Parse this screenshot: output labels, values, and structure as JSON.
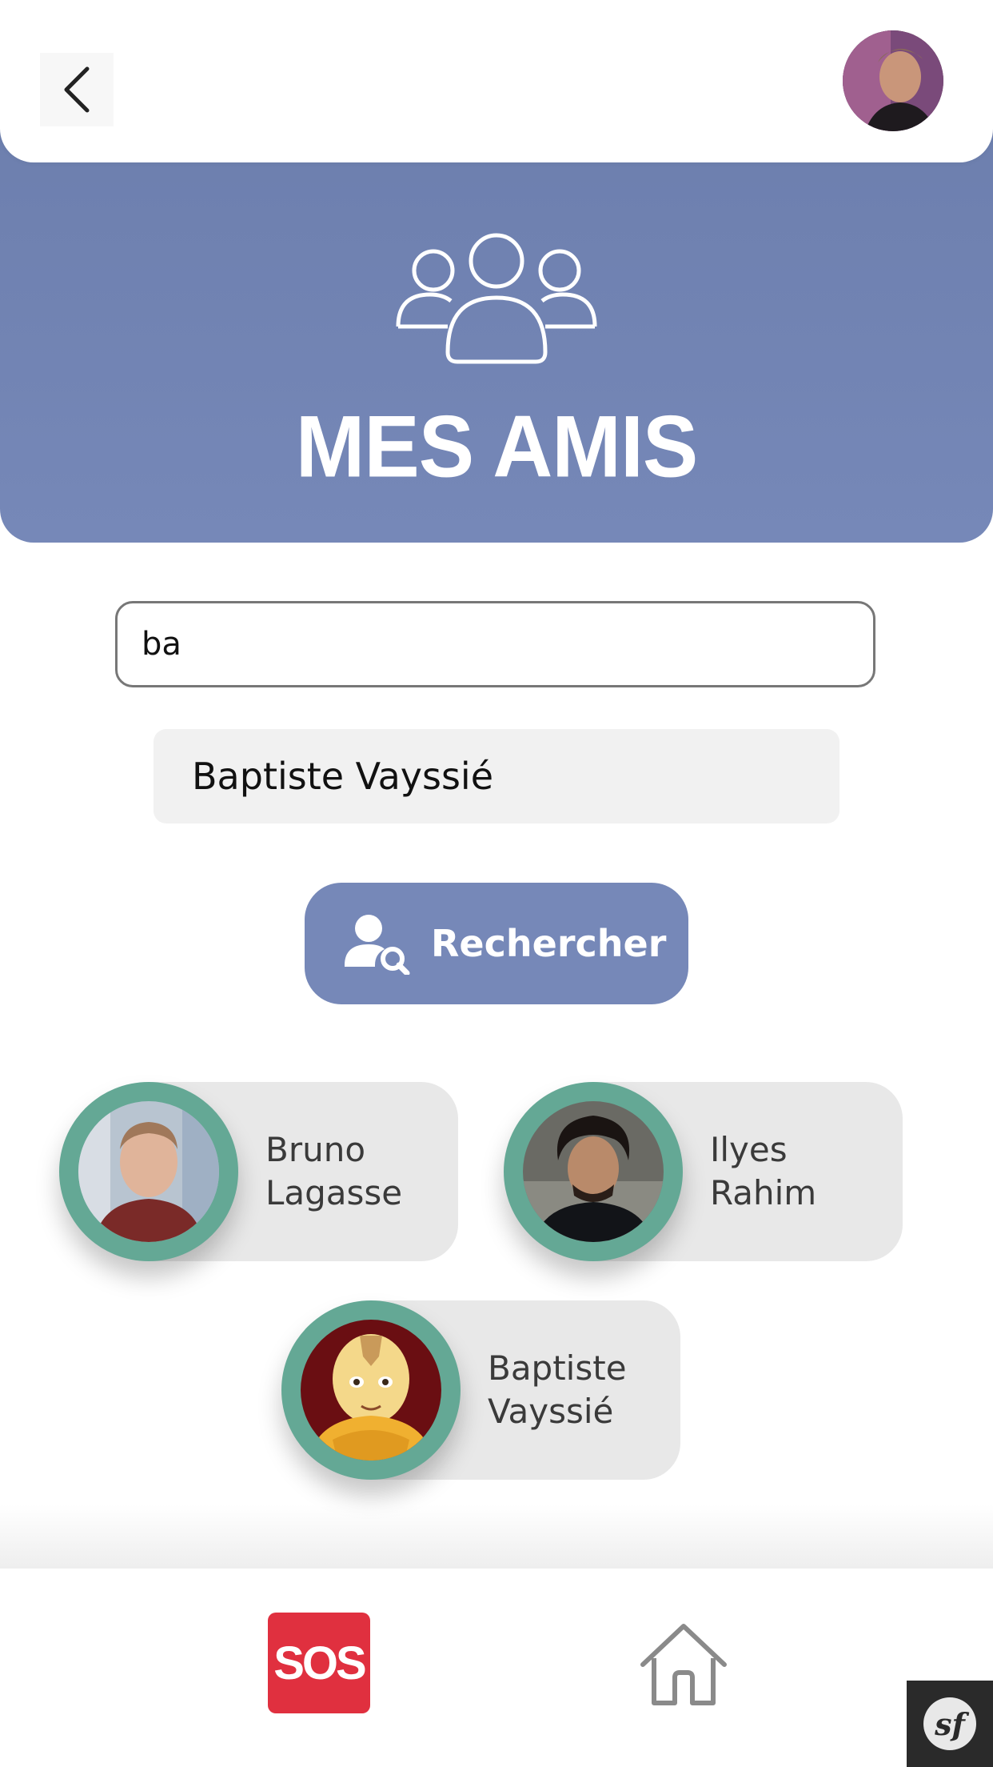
{
  "header": {
    "back_icon": "chevron-left-icon",
    "profile_avatar_icon": "user-avatar"
  },
  "banner": {
    "icon": "users-group-icon",
    "title": "MES AMIS",
    "background_color": "#7688b8"
  },
  "search": {
    "value": "ba",
    "suggestions": [
      "Baptiste Vayssié"
    ],
    "button_label": "Rechercher",
    "button_icon": "user-search-icon"
  },
  "friends": [
    {
      "first_name": "Bruno",
      "last_name": "Lagasse"
    },
    {
      "first_name": "Ilyes",
      "last_name": "Rahim"
    },
    {
      "first_name": "Baptiste",
      "last_name": "Vayssié"
    }
  ],
  "bottom_nav": {
    "sos_label": "SOS",
    "home_icon": "home-icon",
    "sos_color": "#e0303f"
  },
  "debug_badge": {
    "label": "sf"
  },
  "colors": {
    "accent": "#7688b8",
    "ring": "#64a895",
    "card": "#e8e8e8"
  }
}
